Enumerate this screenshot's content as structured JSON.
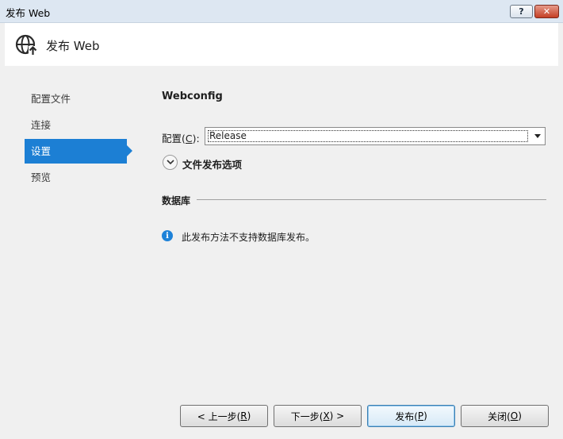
{
  "window": {
    "title": "发布 Web",
    "help_label": "?",
    "close_label": "✕"
  },
  "header": {
    "title": "发布 Web",
    "icon": "globe-arrow-icon"
  },
  "nav": {
    "items": [
      {
        "label": "配置文件",
        "active": false
      },
      {
        "label": "连接",
        "active": false
      },
      {
        "label": "设置",
        "active": true
      },
      {
        "label": "预览",
        "active": false
      }
    ]
  },
  "main": {
    "section_title": "Webconfig",
    "config": {
      "label_prefix": "配置(",
      "accel": "C",
      "label_suffix": "):",
      "value": "Release"
    },
    "file_options_label": "文件发布选项",
    "database_title": "数据库",
    "info_message": "此发布方法不支持数据库发布。"
  },
  "buttons": {
    "prev": {
      "pre": "< 上一步(",
      "accel": "R",
      "post": ")"
    },
    "next": {
      "pre": "下一步(",
      "accel": "X",
      "post": ") >"
    },
    "publish": {
      "pre": "发布(",
      "accel": "P",
      "post": ")"
    },
    "close": {
      "pre": "关闭(",
      "accel": "O",
      "post": ")"
    }
  },
  "colors": {
    "accent": "#1c7fd4",
    "info": "#1e82d8"
  }
}
